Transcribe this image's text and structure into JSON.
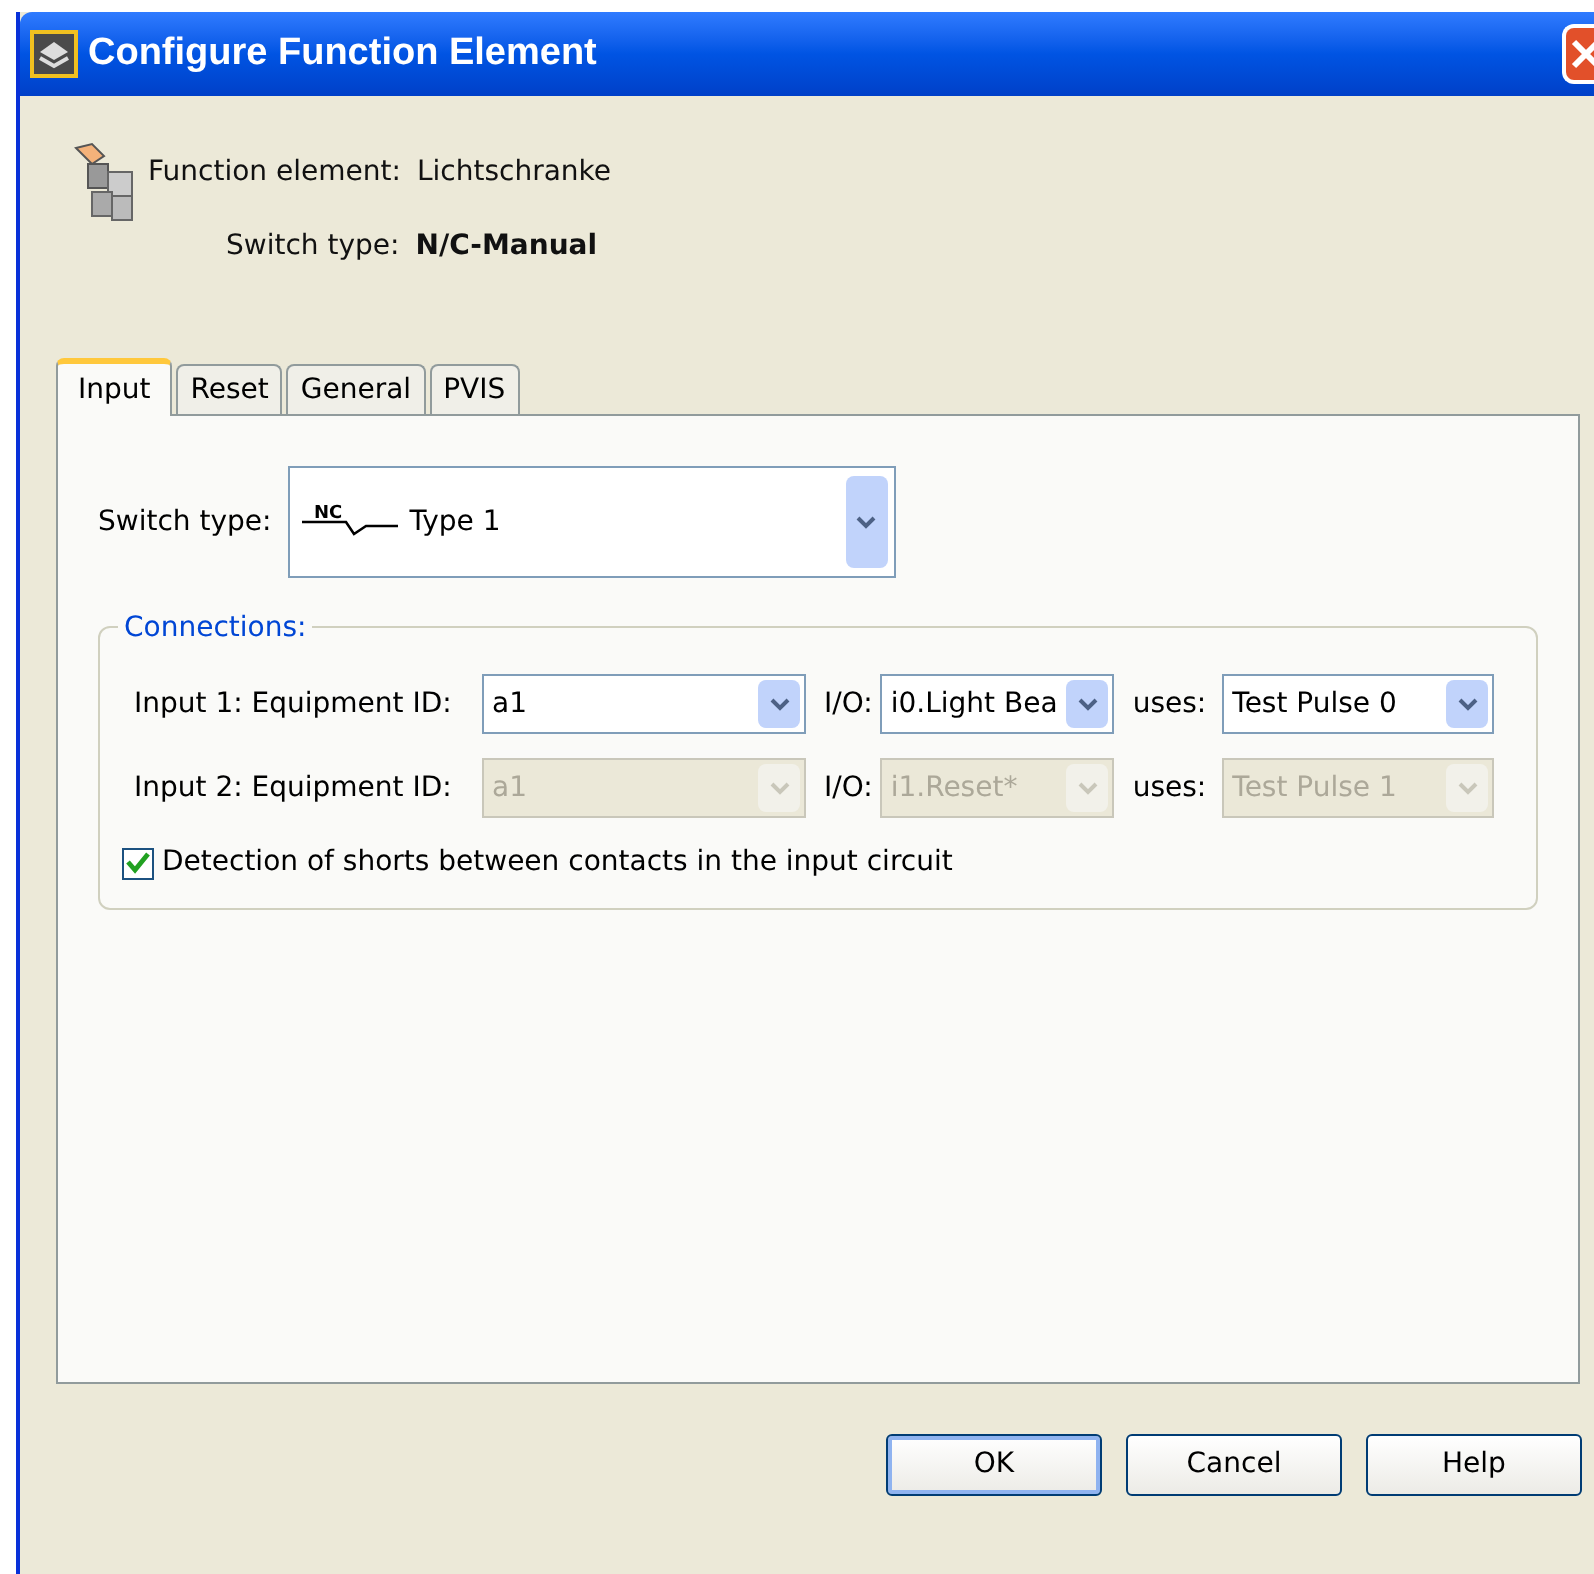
{
  "window": {
    "title": "Configure Function Element"
  },
  "header": {
    "element_label": "Function element:",
    "element_value": "Lichtschranke",
    "type_label": "Switch type:",
    "type_value": "N/C-Manual"
  },
  "tabs": [
    {
      "label": "Input",
      "selected": true
    },
    {
      "label": "Reset",
      "selected": false
    },
    {
      "label": "General",
      "selected": false
    },
    {
      "label": "PVIS",
      "selected": false
    }
  ],
  "switch_type": {
    "label": "Switch type:",
    "symbol_text": "NC",
    "value": "Type 1"
  },
  "connections": {
    "title": "Connections:",
    "rows": [
      {
        "label": "Input 1: Equipment ID:",
        "equipment": "a1",
        "io_label": "I/O:",
        "io": "i0.Light Bea",
        "uses_label": "uses:",
        "uses": "Test Pulse 0",
        "disabled": false
      },
      {
        "label": "Input 2: Equipment ID:",
        "equipment": "a1",
        "io_label": "I/O:",
        "io": "i1.Reset*",
        "uses_label": "uses:",
        "uses": "Test Pulse 1",
        "disabled": true
      }
    ],
    "detection": {
      "label": "Detection of shorts between contacts in the input circuit",
      "checked": true
    }
  },
  "buttons": [
    {
      "label": "OK",
      "default": true
    },
    {
      "label": "Cancel",
      "default": false
    },
    {
      "label": "Help",
      "default": false
    }
  ]
}
